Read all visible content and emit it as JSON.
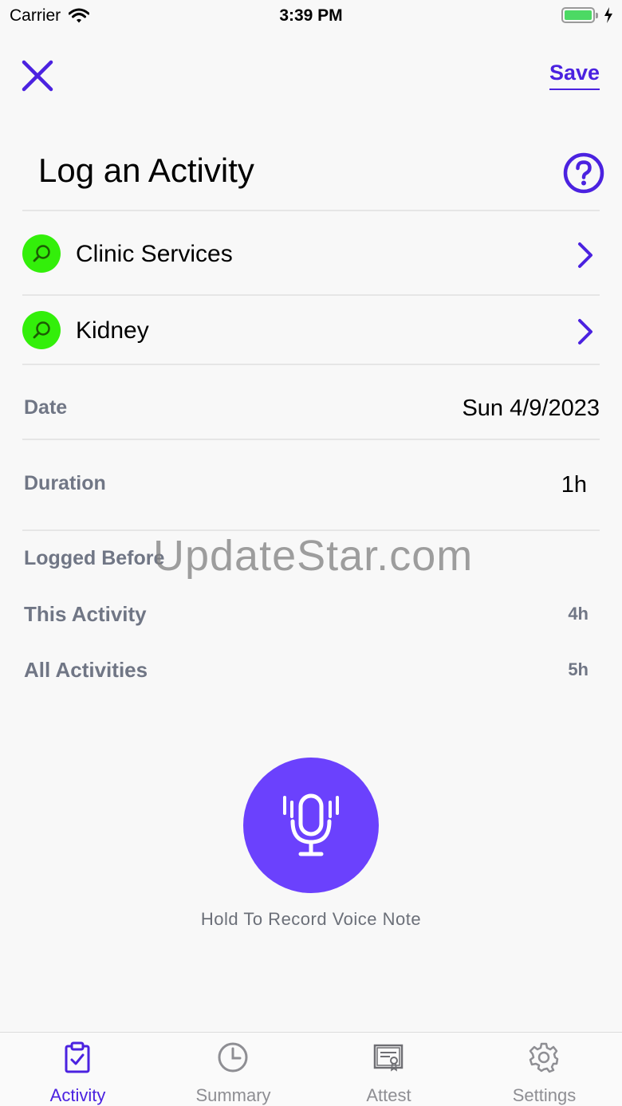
{
  "status_bar": {
    "carrier": "Carrier",
    "time": "3:39 PM"
  },
  "header": {
    "close_icon": "close-icon",
    "save_label": "Save",
    "title": "Log an Activity",
    "help_icon": "help-icon"
  },
  "selections": [
    {
      "label": "Clinic Services",
      "icon": "search-icon"
    },
    {
      "label": "Kidney",
      "icon": "search-icon"
    }
  ],
  "details": {
    "date_label": "Date",
    "date_value": "Sun 4/9/2023",
    "duration_label": "Duration",
    "duration_value": "1h"
  },
  "logged_before": {
    "heading": "Logged Before",
    "this_activity_label": "This Activity",
    "this_activity_value": "4h",
    "all_activities_label": "All Activities",
    "all_activities_value": "5h"
  },
  "watermark": "UpdateStar.com",
  "voice_note": {
    "caption": "Hold To Record Voice Note",
    "icon": "microphone-icon"
  },
  "tabs": [
    {
      "label": "Activity",
      "icon": "clipboard-check-icon",
      "active": true
    },
    {
      "label": "Summary",
      "icon": "clock-icon",
      "active": false
    },
    {
      "label": "Attest",
      "icon": "certificate-icon",
      "active": false
    },
    {
      "label": "Settings",
      "icon": "gear-icon",
      "active": false
    }
  ],
  "colors": {
    "accent": "#4b22e0",
    "mic_button": "#6b41fd",
    "search_badge": "#33ef0a",
    "battery": "#4cd964"
  }
}
